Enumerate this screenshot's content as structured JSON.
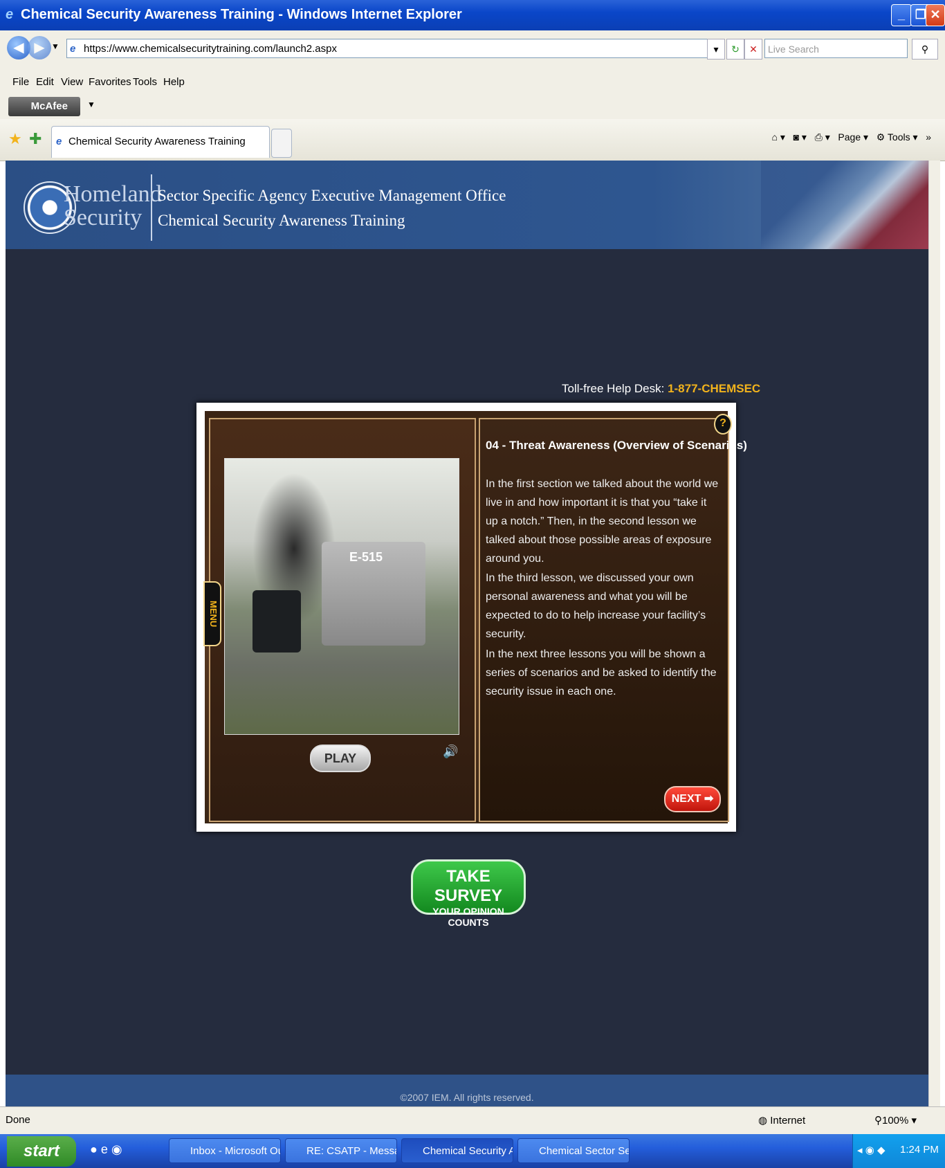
{
  "window": {
    "title": "Chemical Security Awareness Training - Windows Internet Explorer"
  },
  "browser": {
    "address": "https://www.chemicalsecuritytraining.com/launch2.aspx",
    "search_placeholder": "Live Search",
    "menu": [
      "File",
      "Edit",
      "View",
      "Favorites",
      "Tools",
      "Help"
    ],
    "mcafee_label": "McAfee",
    "tab_label": "Chemical Security Awareness Training",
    "commands": {
      "page": "Page",
      "tools": "Tools"
    }
  },
  "header": {
    "brand_line1": "Homeland",
    "brand_line2": "Security",
    "subtitle1": "Sector Specific Agency Executive Management Office",
    "subtitle2": "Chemical Security Awareness Training"
  },
  "helpdesk": {
    "label": "Toll-free Help Desk:",
    "number": "1-877-CHEMSEC"
  },
  "player": {
    "menu_label": "MENU",
    "play_label": "PLAY",
    "help_label": "?",
    "truck_label": "E-515",
    "lesson_title": "04 - Threat Awareness (Overview of Scenarios)",
    "paragraphs": [
      "In the first section we talked about the world we live in and how important it is that you “take it up a notch.” Then, in the second lesson we talked about those possible areas of exposure around you.",
      "In the third lesson, we discussed your own personal awareness and what you will be expected to do to help increase your facility’s security.",
      "In the next three lessons you will be shown a series of scenarios and be asked to identify the security issue in each one."
    ],
    "next_label": "NEXT"
  },
  "survey": {
    "line1": "TAKE SURVEY",
    "line2": "YOUR OPINION COUNTS"
  },
  "footer": {
    "copyright": "©2007 IEM. All rights reserved."
  },
  "statusbar": {
    "status": "Done",
    "zone": "Internet",
    "zoom": "100%"
  },
  "taskbar": {
    "start": "start",
    "items": [
      "Inbox - Microsoft Out...",
      "RE: CSATP - Message...",
      "Chemical Security Aw...",
      "Chemical Sector Secu..."
    ],
    "clock": "1:24 PM"
  },
  "colors": {
    "page_bg": "#252c3e",
    "banner": "#2e5690",
    "accent_yellow": "#f2b31c",
    "next_red": "#d8251a",
    "survey_green": "#2aa836"
  }
}
